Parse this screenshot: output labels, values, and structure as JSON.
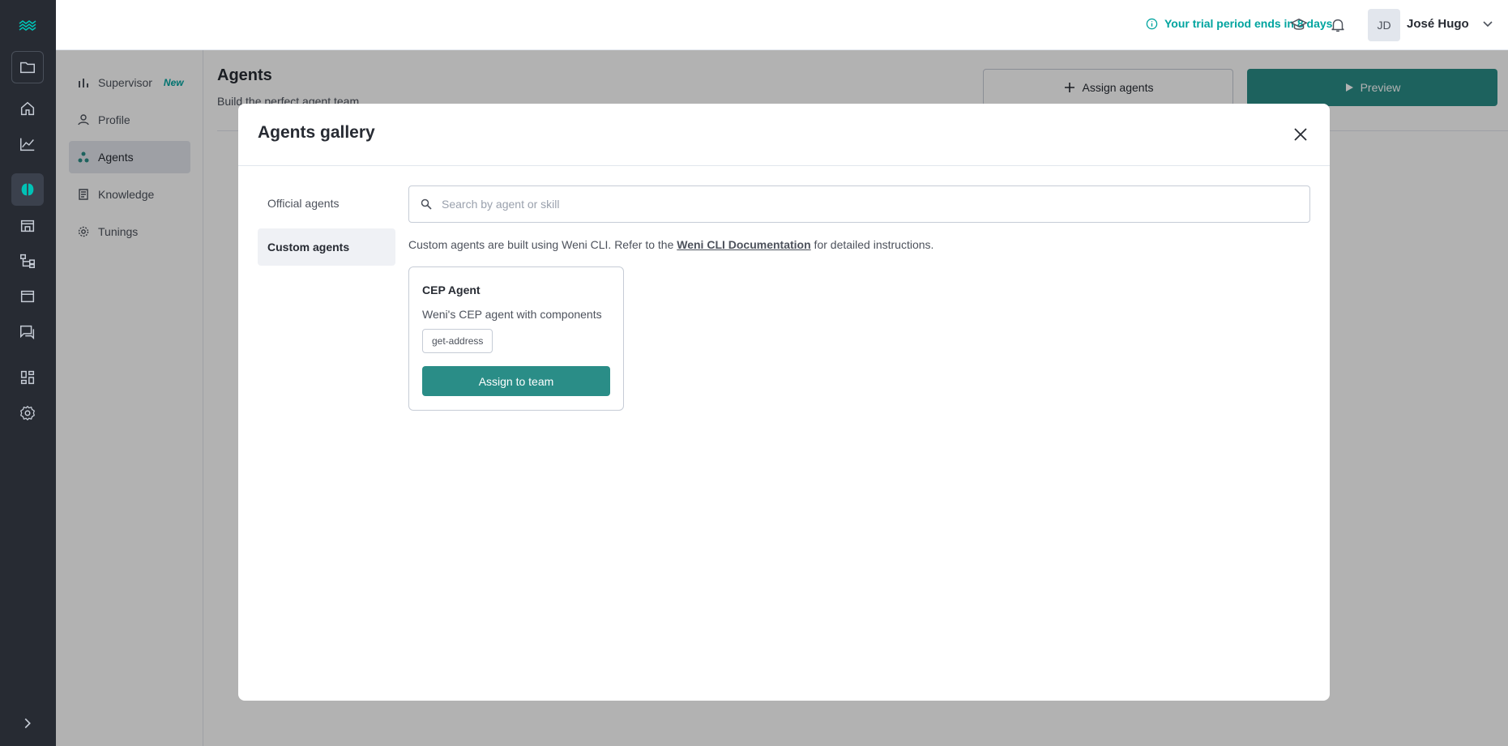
{
  "colors": {
    "rail": "#272b33",
    "accent": "#00a49f",
    "primary_button": "#2a8d87"
  },
  "rail": {
    "items": [
      "weni-logo-icon",
      "folder-icon",
      "home-icon",
      "chart-icon",
      "brain-icon",
      "store-icon",
      "flows-icon",
      "browser-icon",
      "chats-icon",
      "apps-icon",
      "settings-icon",
      "expand-icon"
    ]
  },
  "header": {
    "trial_text": "Your trial period ends in 8 days",
    "avatar_initials": "JD",
    "user_name": "José Hugo"
  },
  "subnav": {
    "items": [
      {
        "label": "Supervisor",
        "badge": "New"
      },
      {
        "label": "Profile"
      },
      {
        "label": "Agents"
      },
      {
        "label": "Knowledge"
      },
      {
        "label": "Tunings"
      }
    ]
  },
  "page": {
    "title": "Agents",
    "subtitle": "Build the perfect agent team",
    "assign_agents_label": "Assign agents",
    "preview_label": "Preview"
  },
  "modal": {
    "title": "Agents gallery",
    "tabs": [
      {
        "label": "Official agents"
      },
      {
        "label": "Custom agents"
      }
    ],
    "search_placeholder": "Search by agent or skill",
    "search_value": "",
    "info_prefix": "Custom agents are built using Weni CLI.  Refer to the ",
    "info_link": "Weni CLI Documentation",
    "info_suffix": " for detailed instructions.",
    "card": {
      "title": "CEP Agent",
      "description": "Weni's CEP agent with components",
      "tag": "get-address",
      "button_label": "Assign to team"
    }
  }
}
